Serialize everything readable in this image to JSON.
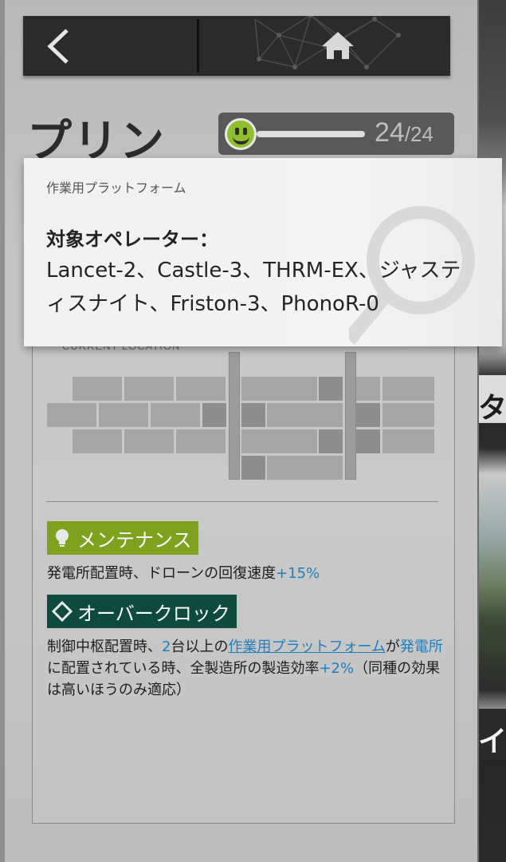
{
  "header": {
    "back_label": "back",
    "home_label": "home"
  },
  "operator": {
    "name": "プリン"
  },
  "mood": {
    "current": "24",
    "max": "/24",
    "level": 1.0
  },
  "location": {
    "label": "CURRENT LOCATION",
    "dash": "—"
  },
  "skills": [
    {
      "name": "メンテナンス",
      "icon": "lightbulb-icon",
      "color": "#7ea21f",
      "desc_prefix": "発電所配置時、ドローンの回復速度",
      "desc_value": "+15%"
    },
    {
      "name": "オーバークロック",
      "icon": "diamond-icon",
      "color": "#0f4a3e",
      "desc_1": "制御中枢配置時、",
      "desc_2": "2",
      "desc_3": "台以上の",
      "desc_link": "作業用プラットフォーム",
      "desc_4": "が",
      "desc_5": "発電所",
      "desc_6": "に配置されている時、全製造所の製造効率",
      "desc_7": "+2%",
      "desc_8": "（同種の効果は高いほうのみ適応）"
    }
  ],
  "tooltip": {
    "title": "作業用プラットフォーム",
    "heading": "対象オペレーター：",
    "body": "Lancet-2、Castle-3、THRM-EX、ジャスティスナイト、Friston-3、PhonoR-0"
  },
  "side": {
    "label_a": "タグ",
    "label_b": "イル"
  },
  "colors": {
    "accent_blue": "#1e7fc0",
    "mood_green": "#8fbf2e",
    "topbar": "#2b2b2b"
  }
}
